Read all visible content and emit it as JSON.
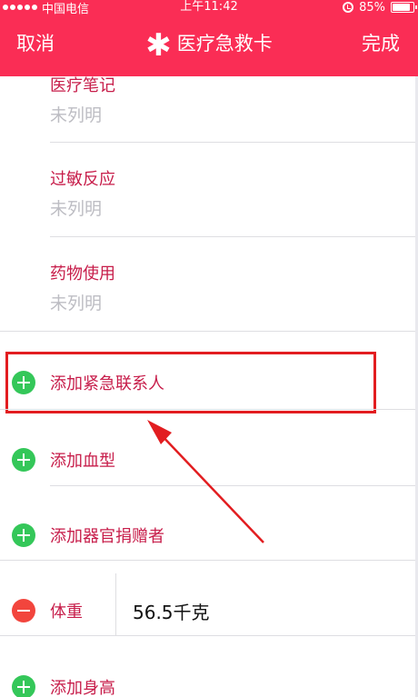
{
  "status_bar": {
    "carrier": "中国电信",
    "time": "上午11:42",
    "battery": "85%",
    "battery_level": 0.85
  },
  "nav": {
    "cancel_label": "取消",
    "title": "医疗急救卡",
    "done_label": "完成",
    "title_icon": "asterisk-icon"
  },
  "notes": [
    {
      "label": "医疗笔记",
      "value": "未列明"
    },
    {
      "label": "过敏反应",
      "value": "未列明"
    },
    {
      "label": "药物使用",
      "value": "未列明"
    }
  ],
  "actions": {
    "add_emergency_contact": "添加紧急联系人",
    "add_blood_type": "添加血型",
    "add_organ_donor": "添加器官捐赠者",
    "add_height": "添加身高"
  },
  "weight": {
    "label": "体重",
    "value": "56.5千克"
  },
  "colors": {
    "accent": "#fa2d55",
    "label": "#c71d4a",
    "add": "#34c759",
    "remove": "#f2453d",
    "annotation": "#e21d20"
  }
}
